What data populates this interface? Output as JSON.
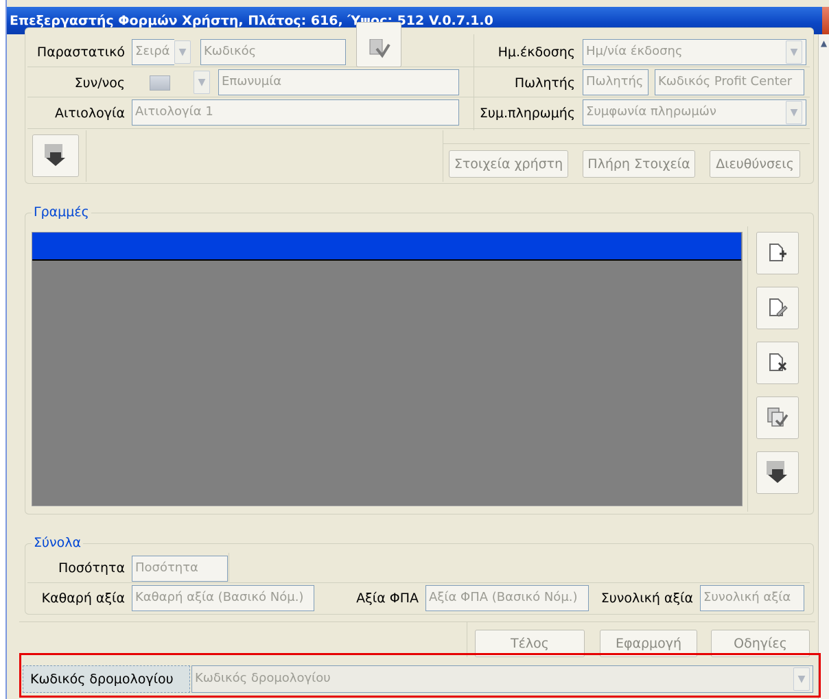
{
  "window": {
    "title": "Επεξεργαστής Φορμών Χρήστη, Πλάτος: 616, Ύψος: 512 V.0.7.1.0"
  },
  "header": {
    "document_label": "Παραστατικό",
    "series_placeholder": "Σειρά",
    "code_placeholder": "Κωδικός",
    "customer_label": "Συν/νος",
    "name_placeholder": "Επωνυμία",
    "reason_label": "Αιτιολογία",
    "reason_value": "Αιτιολογία 1",
    "issue_date_label": "Ημ.έκδοσης",
    "issue_date_placeholder": "Ημ/νία έκδοσης",
    "seller_label": "Πωλητής",
    "seller_placeholder": "Πωλητής",
    "profit_center_placeholder": "Κωδικός Profit Center",
    "payment_label": "Συμ.πληρωμής",
    "payment_placeholder": "Συμφωνία πληρωμών",
    "user_data_button": "Στοιχεία χρήστη",
    "full_data_button": "Πλήρη Στοιχεία",
    "addresses_button": "Διευθύνσεις"
  },
  "lines": {
    "title": "Γραμμές"
  },
  "totals": {
    "title": "Σύνολα",
    "quantity_label": "Ποσότητα",
    "quantity_placeholder": "Ποσότητα",
    "net_value_label": "Καθαρή αξία",
    "net_value_placeholder": "Καθαρή αξία (Βασικό Νόμ.)",
    "vat_label": "Αξία ΦΠΑ",
    "vat_placeholder": "Αξία ΦΠΑ (Βασικό Νόμ.)",
    "total_label": "Συνολική αξία",
    "total_placeholder": "Συνολική αξία"
  },
  "footer": {
    "finish_button": "Τέλος",
    "apply_button": "Εφαρμογή",
    "help_button": "Οδηγίες"
  },
  "route": {
    "label": "Κωδικός δρομολογίου",
    "placeholder": "Κωδικός δρομολογίου"
  },
  "icons": {
    "import": "import-icon",
    "add_line": "add-line-icon",
    "edit_line": "edit-line-icon",
    "delete_line": "delete-line-icon",
    "copy_line": "copy-line-icon",
    "import_lines": "import-lines-icon"
  }
}
